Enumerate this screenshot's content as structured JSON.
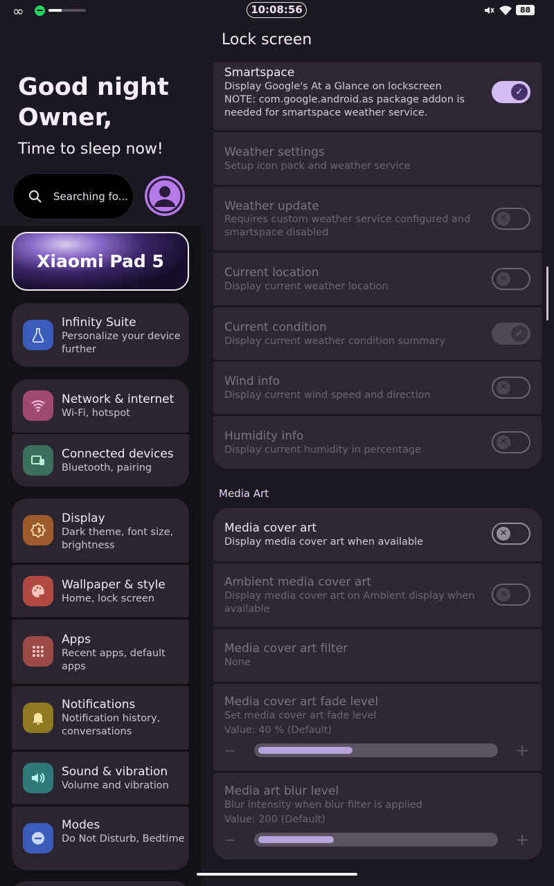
{
  "status_bar": {
    "time": "10:08:56",
    "battery": "88",
    "media_progress": 0.35
  },
  "home": {
    "greeting_line1": "Good night",
    "greeting_line2": "Owner,",
    "greeting_line3": "Time to sleep now!",
    "search_placeholder": "Searching fo...",
    "device_name": "Xiaomi Pad 5"
  },
  "sidebar": {
    "items": [
      {
        "title": "Infinity Suite",
        "subtitle": "Personalize your device further",
        "icon": "flask-icon",
        "color": "#3b5bb8"
      },
      {
        "title": "Network & internet",
        "subtitle": "Wi-Fi, hotspot",
        "icon": "wifi-icon",
        "color": "#a04a73"
      },
      {
        "title": "Connected devices",
        "subtitle": "Bluetooth, pairing",
        "icon": "devices-icon",
        "color": "#3d6e5c"
      },
      {
        "title": "Display",
        "subtitle": "Dark theme, font size, brightness",
        "icon": "brightness-icon",
        "color": "#9e5a2a"
      },
      {
        "title": "Wallpaper & style",
        "subtitle": "Home, lock screen",
        "icon": "palette-icon",
        "color": "#b04a40"
      },
      {
        "title": "Apps",
        "subtitle": "Recent apps, default apps",
        "icon": "apps-grid-icon",
        "color": "#9c4a48"
      },
      {
        "title": "Notifications",
        "subtitle": "Notification history, conversations",
        "icon": "bell-icon",
        "color": "#8f7a22"
      },
      {
        "title": "Sound & vibration",
        "subtitle": "Volume and vibration",
        "icon": "speaker-icon",
        "color": "#2f7a78"
      },
      {
        "title": "Modes",
        "subtitle": "Do Not Disturb, Bedtime",
        "icon": "dnd-icon",
        "color": "#3b5bb8"
      }
    ]
  },
  "main": {
    "title": "Lock screen",
    "settings": [
      {
        "title": "Smartspace",
        "subtitle": "Display Google's At a Glance on lockscreen\nNOTE: com.google.android.as package addon is needed for smartspace weather service.",
        "toggle": "on",
        "enabled": true
      },
      {
        "title": "Weather settings",
        "subtitle": "Setup icon pack and weather service",
        "enabled": false
      },
      {
        "title": "Weather update",
        "subtitle": "Requires custom weather service configured and smartspace disabled",
        "toggle": "off",
        "enabled": false
      },
      {
        "title": "Current location",
        "subtitle": "Display current weather location",
        "toggle": "off",
        "enabled": false
      },
      {
        "title": "Current condition",
        "subtitle": "Display current weather condition summary",
        "toggle": "on",
        "enabled": false
      },
      {
        "title": "Wind info",
        "subtitle": "Display current wind speed and direction",
        "toggle": "off",
        "enabled": false
      },
      {
        "title": "Humidity info",
        "subtitle": "Display current humidity in percentage",
        "toggle": "off",
        "enabled": false
      }
    ],
    "media_section_label": "Media Art",
    "media_settings": [
      {
        "title": "Media cover art",
        "subtitle": "Display media cover art when available",
        "toggle": "off",
        "enabled": true
      },
      {
        "title": "Ambient media cover art",
        "subtitle": "Display media cover art on Ambient display when available",
        "toggle": "off",
        "enabled": false
      },
      {
        "title": "Media cover art filter",
        "subtitle": "None",
        "enabled": false
      },
      {
        "title": "Media cover art fade level",
        "subtitle": "Set media cover art fade level",
        "value": "Value: 40 % (Default)",
        "level": 0.4,
        "enabled": false
      },
      {
        "title": "Media art blur level",
        "subtitle": "Blur intensity when blur filter is applied",
        "value": "Value: 200 (Default)",
        "level": 0.32,
        "enabled": false
      }
    ],
    "slider_minus": "−",
    "slider_plus": "+"
  },
  "colors": {
    "accent": "#d3bcf2",
    "background": "#1c1822",
    "card": "#2e2836"
  }
}
